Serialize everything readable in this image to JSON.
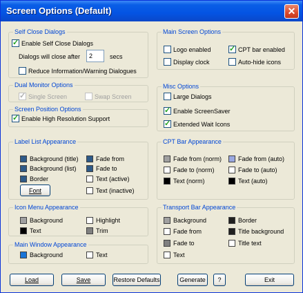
{
  "window": {
    "title": "Screen Options (Default)",
    "close_glyph": "✕"
  },
  "self_close": {
    "legend": "Self Close Dialogs",
    "enable_label": "Enable Self Close Dialogs",
    "enable_checked": true,
    "close_after_label": "Dialogs will close after",
    "close_after_value": "2",
    "close_after_unit": "secs",
    "reduce_label": "Reduce Information/Warning Dialogues",
    "reduce_checked": false
  },
  "main_screen": {
    "legend": "Main Screen Options",
    "logo_label": "Logo enabled",
    "logo_checked": false,
    "cpt_label": "CPT bar enabled",
    "cpt_checked": true,
    "clock_label": "Display clock",
    "clock_checked": false,
    "autohide_label": "Auto-hide icons",
    "autohide_checked": false
  },
  "dual_monitor": {
    "legend": "Dual Monitor Options",
    "single_label": "Single Screen",
    "single_checked": true,
    "swap_label": "Swap Screen",
    "swap_checked": false
  },
  "misc": {
    "legend": "Misc Options",
    "large_label": "Large Dialogs",
    "large_checked": false,
    "saver_label": "Enable ScreenSaver",
    "saver_checked": true,
    "wait_label": "Extended Wait Icons",
    "wait_checked": true
  },
  "screen_position": {
    "legend": "Screen Position Options",
    "highres_label": "Enable High Resolution Support",
    "highres_checked": true
  },
  "label_list": {
    "legend": "Label List Appearance",
    "bg_title": "Background (title)",
    "bg_title_color": "#2e5a88",
    "bg_list": "Background (list)",
    "bg_list_color": "#2e5a88",
    "border": "Border",
    "border_color": "#2e5a88",
    "fade_from": "Fade from",
    "fade_from_color": "#2e5a88",
    "fade_to": "Fade to",
    "fade_to_color": "#2e5a88",
    "text_active": "Text (active)",
    "text_active_color": "#ffffff",
    "text_inactive": "Text (inactive)",
    "text_inactive_color": "#ffffff",
    "font_button": "Font"
  },
  "cpt_bar": {
    "legend": "CPT Bar Appearance",
    "fade_from_norm": "Fade from (norm)",
    "fade_from_norm_color": "#a0a0a0",
    "fade_from_auto": "Fade from (auto)",
    "fade_from_auto_color": "#9aa8e0",
    "fade_to_norm": "Fade to (norm)",
    "fade_to_norm_color": "#ffffff",
    "fade_to_auto": "Fade to (auto)",
    "fade_to_auto_color": "#ffffff",
    "text_norm": "Text (norm)",
    "text_norm_color": "#000000",
    "text_auto": "Text (auto)",
    "text_auto_color": "#000000"
  },
  "icon_menu": {
    "legend": "Icon Menu Appearance",
    "background": "Background",
    "background_color": "#a0a0a0",
    "highlight": "Highlight",
    "highlight_color": "#ffffff",
    "text": "Text",
    "text_color": "#000000",
    "trim": "Trim",
    "trim_color": "#808080"
  },
  "main_window": {
    "legend": "Main Window Appearance",
    "background": "Background",
    "background_color": "#1874d8",
    "text": "Text",
    "text_color": "#ffffff"
  },
  "transport_bar": {
    "legend": "Transport Bar Appearance",
    "background": "Background",
    "background_color": "#a0a0a0",
    "border": "Border",
    "border_color": "#202020",
    "fade_from": "Fade from",
    "fade_from_color": "#ffffff",
    "title_bg": "Title background",
    "title_bg_color": "#202020",
    "fade_to": "Fade to",
    "fade_to_color": "#808080",
    "title_text": "Title text",
    "title_text_color": "#ffffff",
    "text": "Text",
    "text_color": "#ffffff"
  },
  "buttons": {
    "load": "Load",
    "save": "Save",
    "restore": "Restore Defaults",
    "generate": "Generate",
    "help": "?",
    "exit": "Exit"
  }
}
